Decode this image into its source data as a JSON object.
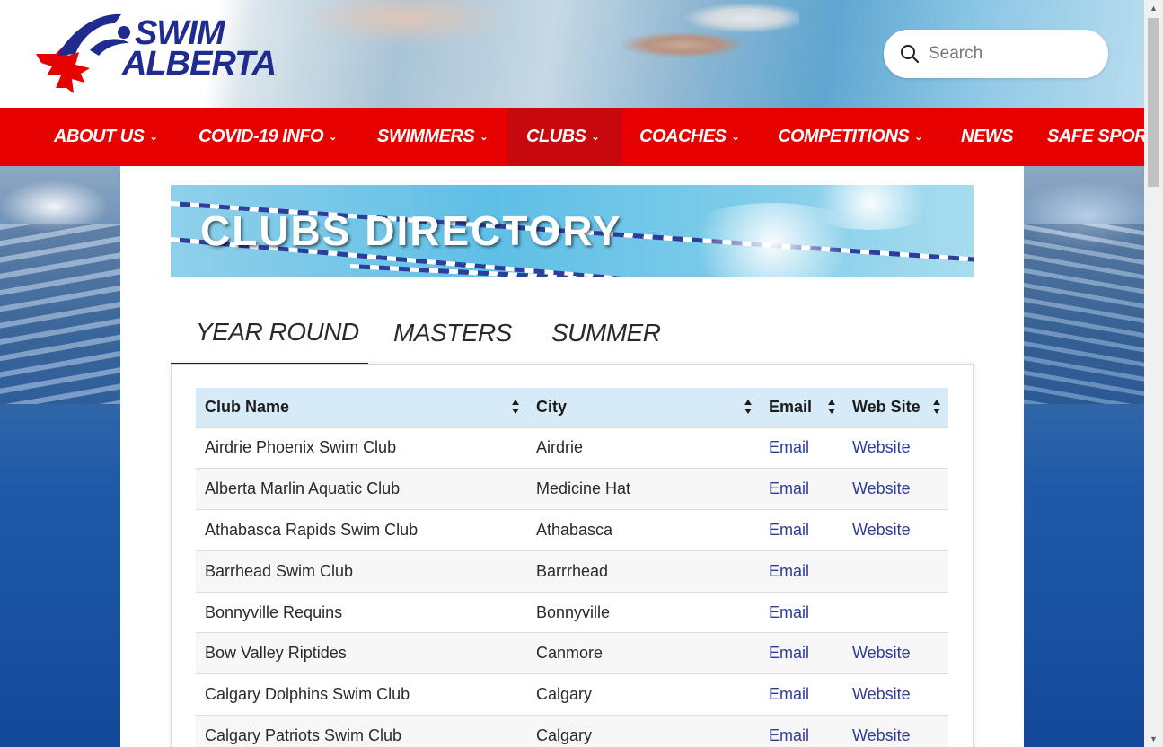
{
  "brand": {
    "logo_line1": "SWIM",
    "logo_line2": "ALBERTA",
    "red": "#e60000",
    "navy": "#1f2b8f"
  },
  "search": {
    "placeholder": "Search",
    "icon": "search-icon"
  },
  "nav": {
    "items": [
      {
        "label": "ABOUT US",
        "has_dropdown": true
      },
      {
        "label": "COVID-19 INFO",
        "has_dropdown": true
      },
      {
        "label": "SWIMMERS",
        "has_dropdown": true
      },
      {
        "label": "CLUBS",
        "has_dropdown": true,
        "active": true
      },
      {
        "label": "COACHES",
        "has_dropdown": true
      },
      {
        "label": "COMPETITIONS",
        "has_dropdown": true
      },
      {
        "label": "NEWS",
        "has_dropdown": false
      },
      {
        "label": "SAFE SPOR",
        "has_dropdown": false
      }
    ]
  },
  "page": {
    "title": "CLUBS DIRECTORY"
  },
  "tabs": [
    {
      "label": "YEAR ROUND",
      "active": true
    },
    {
      "label": "MASTERS",
      "active": false
    },
    {
      "label": "SUMMER",
      "active": false
    }
  ],
  "table": {
    "headers": [
      "Club Name",
      "City",
      "Email",
      "Web Site"
    ],
    "rows": [
      {
        "club": "Airdrie Phoenix Swim Club",
        "city": "Airdrie",
        "email": "Email",
        "website": "Website"
      },
      {
        "club": "Alberta Marlin Aquatic Club",
        "city": "Medicine Hat",
        "email": "Email",
        "website": "Website"
      },
      {
        "club": "Athabasca Rapids Swim Club",
        "city": "Athabasca",
        "email": "Email",
        "website": "Website"
      },
      {
        "club": "Barrhead Swim Club",
        "city": "Barrrhead",
        "email": "Email",
        "website": ""
      },
      {
        "club": "Bonnyville Requins",
        "city": "Bonnyville",
        "email": "Email",
        "website": ""
      },
      {
        "club": "Bow Valley Riptides",
        "city": "Canmore",
        "email": "Email",
        "website": "Website"
      },
      {
        "club": "Calgary Dolphins Swim Club",
        "city": "Calgary",
        "email": "Email",
        "website": "Website"
      },
      {
        "club": "Calgary Patriots Swim Club",
        "city": "Calgary",
        "email": "Email",
        "website": "Website"
      }
    ]
  }
}
